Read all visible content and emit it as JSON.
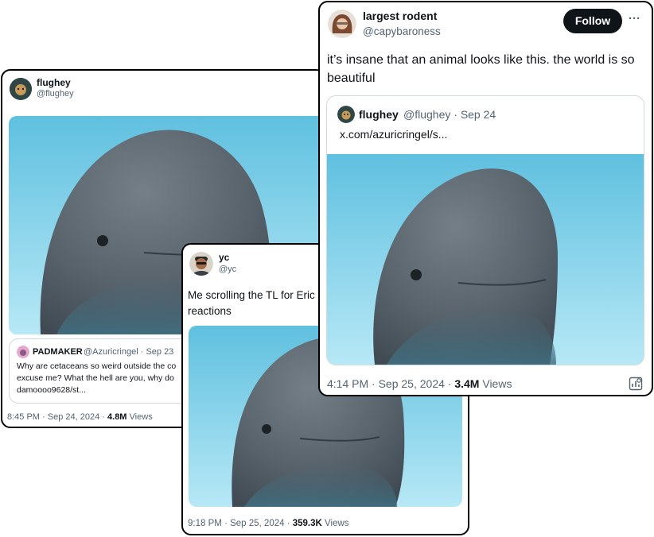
{
  "tweet_left": {
    "author_name": "flughey",
    "author_handle": "@flughey",
    "quote": {
      "author_name": "PADMAKER",
      "author_handle": "@Azuricringel",
      "date": "Sep 23",
      "text": "Why are cetaceans so weird outside the co excuse me? What the hell are you, why do damoooo9628/st..."
    },
    "time": "8:45 PM",
    "date": "Sep 24, 2024",
    "views_count": "4.8M",
    "views_label": "Views"
  },
  "tweet_middle": {
    "author_name": "yc",
    "author_handle": "@yc",
    "text": "Me scrolling the TL for Eric reactions",
    "time": "9:18 PM",
    "date": "Sep 25, 2024",
    "views_count": "359.3K",
    "views_label": "Views"
  },
  "tweet_right": {
    "author_name": "largest rodent",
    "author_handle": "@capybaroness",
    "follow_label": "Follow",
    "more_label": "···",
    "text": "it’s insane that an animal looks like this. the world is so beautiful",
    "quote": {
      "author_name": "flughey",
      "author_handle": "@flughey",
      "date": "Sep 24",
      "link": "x.com/azuricringel/s..."
    },
    "time": "4:14 PM",
    "date": "Sep 25, 2024",
    "views_count": "3.4M",
    "views_label": "Views"
  },
  "sep": "·",
  "colors": {
    "sky_top": "#63c3e2",
    "sky_bottom": "#b9e9f7",
    "whale": "#5b6670",
    "secondary_text": "#536471"
  }
}
